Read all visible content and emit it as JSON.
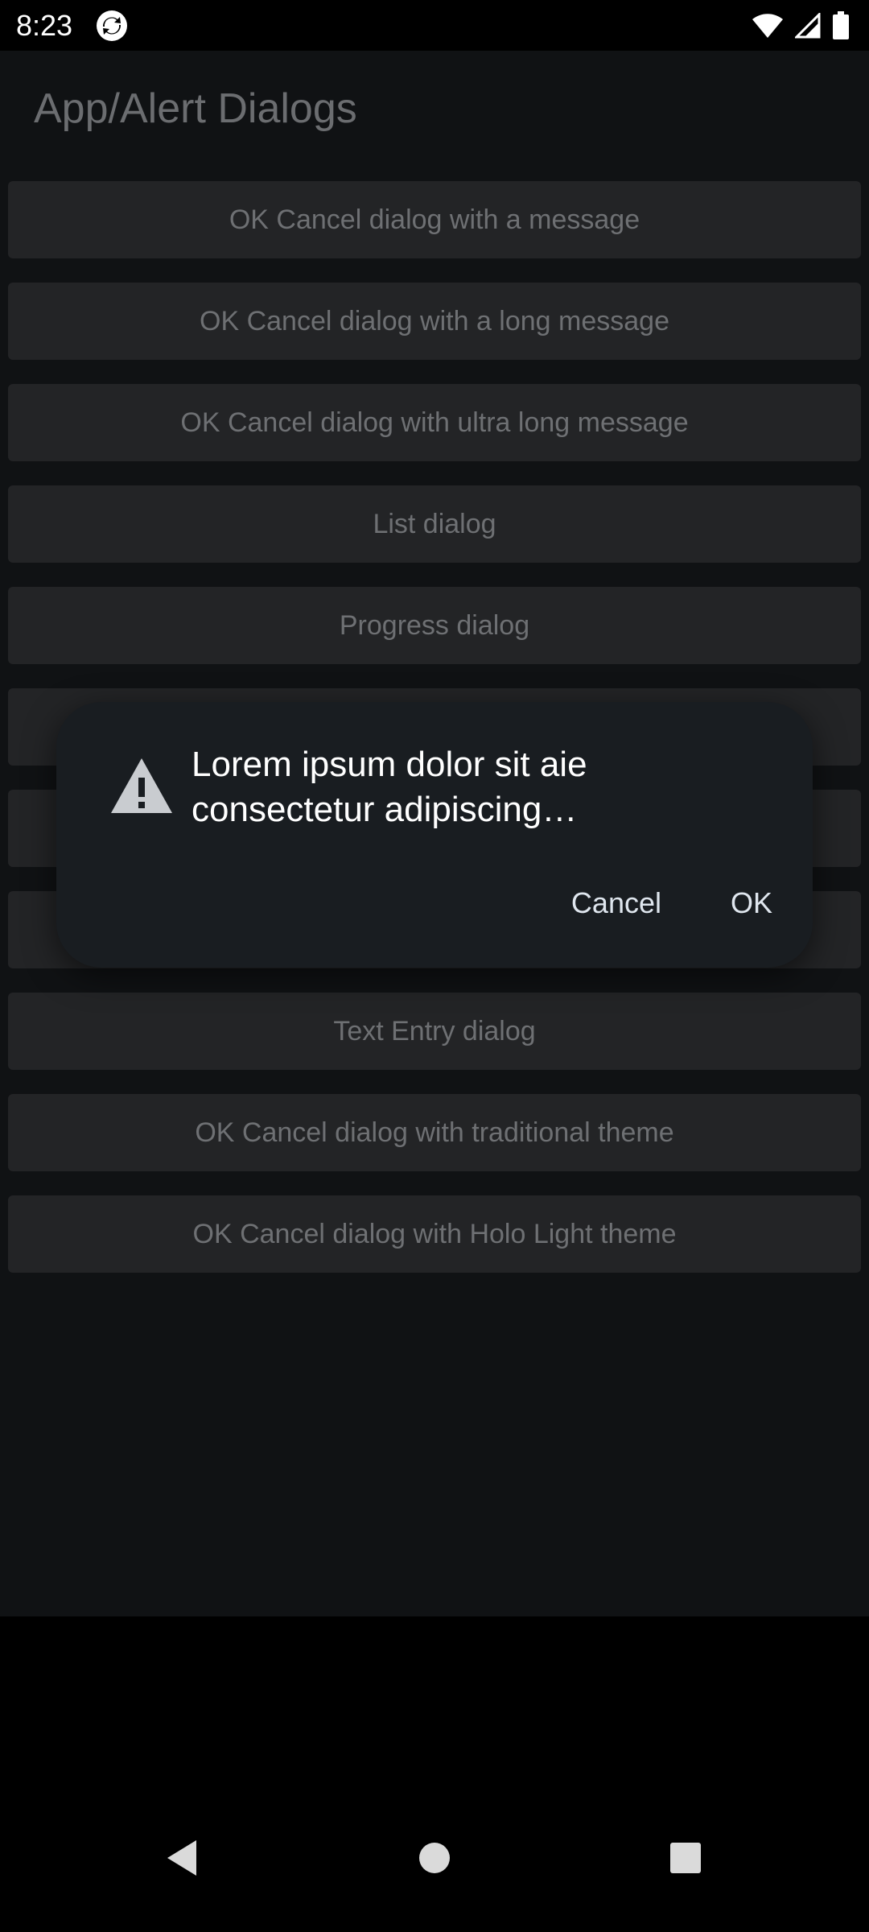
{
  "status_bar": {
    "time": "8:23",
    "app_icon": "sync-app-icon",
    "icons": [
      "wifi-icon",
      "cell-signal-icon",
      "battery-icon"
    ]
  },
  "app": {
    "title": "App/Alert Dialogs",
    "buttons": [
      "OK Cancel dialog with a message",
      "OK Cancel dialog with a long message",
      "OK Cancel dialog with ultra long message",
      "List dialog",
      "Progress dialog",
      "",
      "",
      "",
      "Text Entry dialog",
      "OK Cancel dialog with traditional theme",
      "OK Cancel dialog with Holo Light theme"
    ]
  },
  "dialog": {
    "icon": "warning-icon",
    "title": "Lorem ipsum dolor sit aie consectetur adipiscing…",
    "cancel_label": "Cancel",
    "ok_label": "OK"
  },
  "nav_bar": {
    "icons": [
      "back-icon",
      "home-icon",
      "recents-icon"
    ]
  },
  "colors": {
    "background": "#101214",
    "button": "#232426",
    "dialog": "#191d21",
    "dialog_text": "#ffffff"
  }
}
